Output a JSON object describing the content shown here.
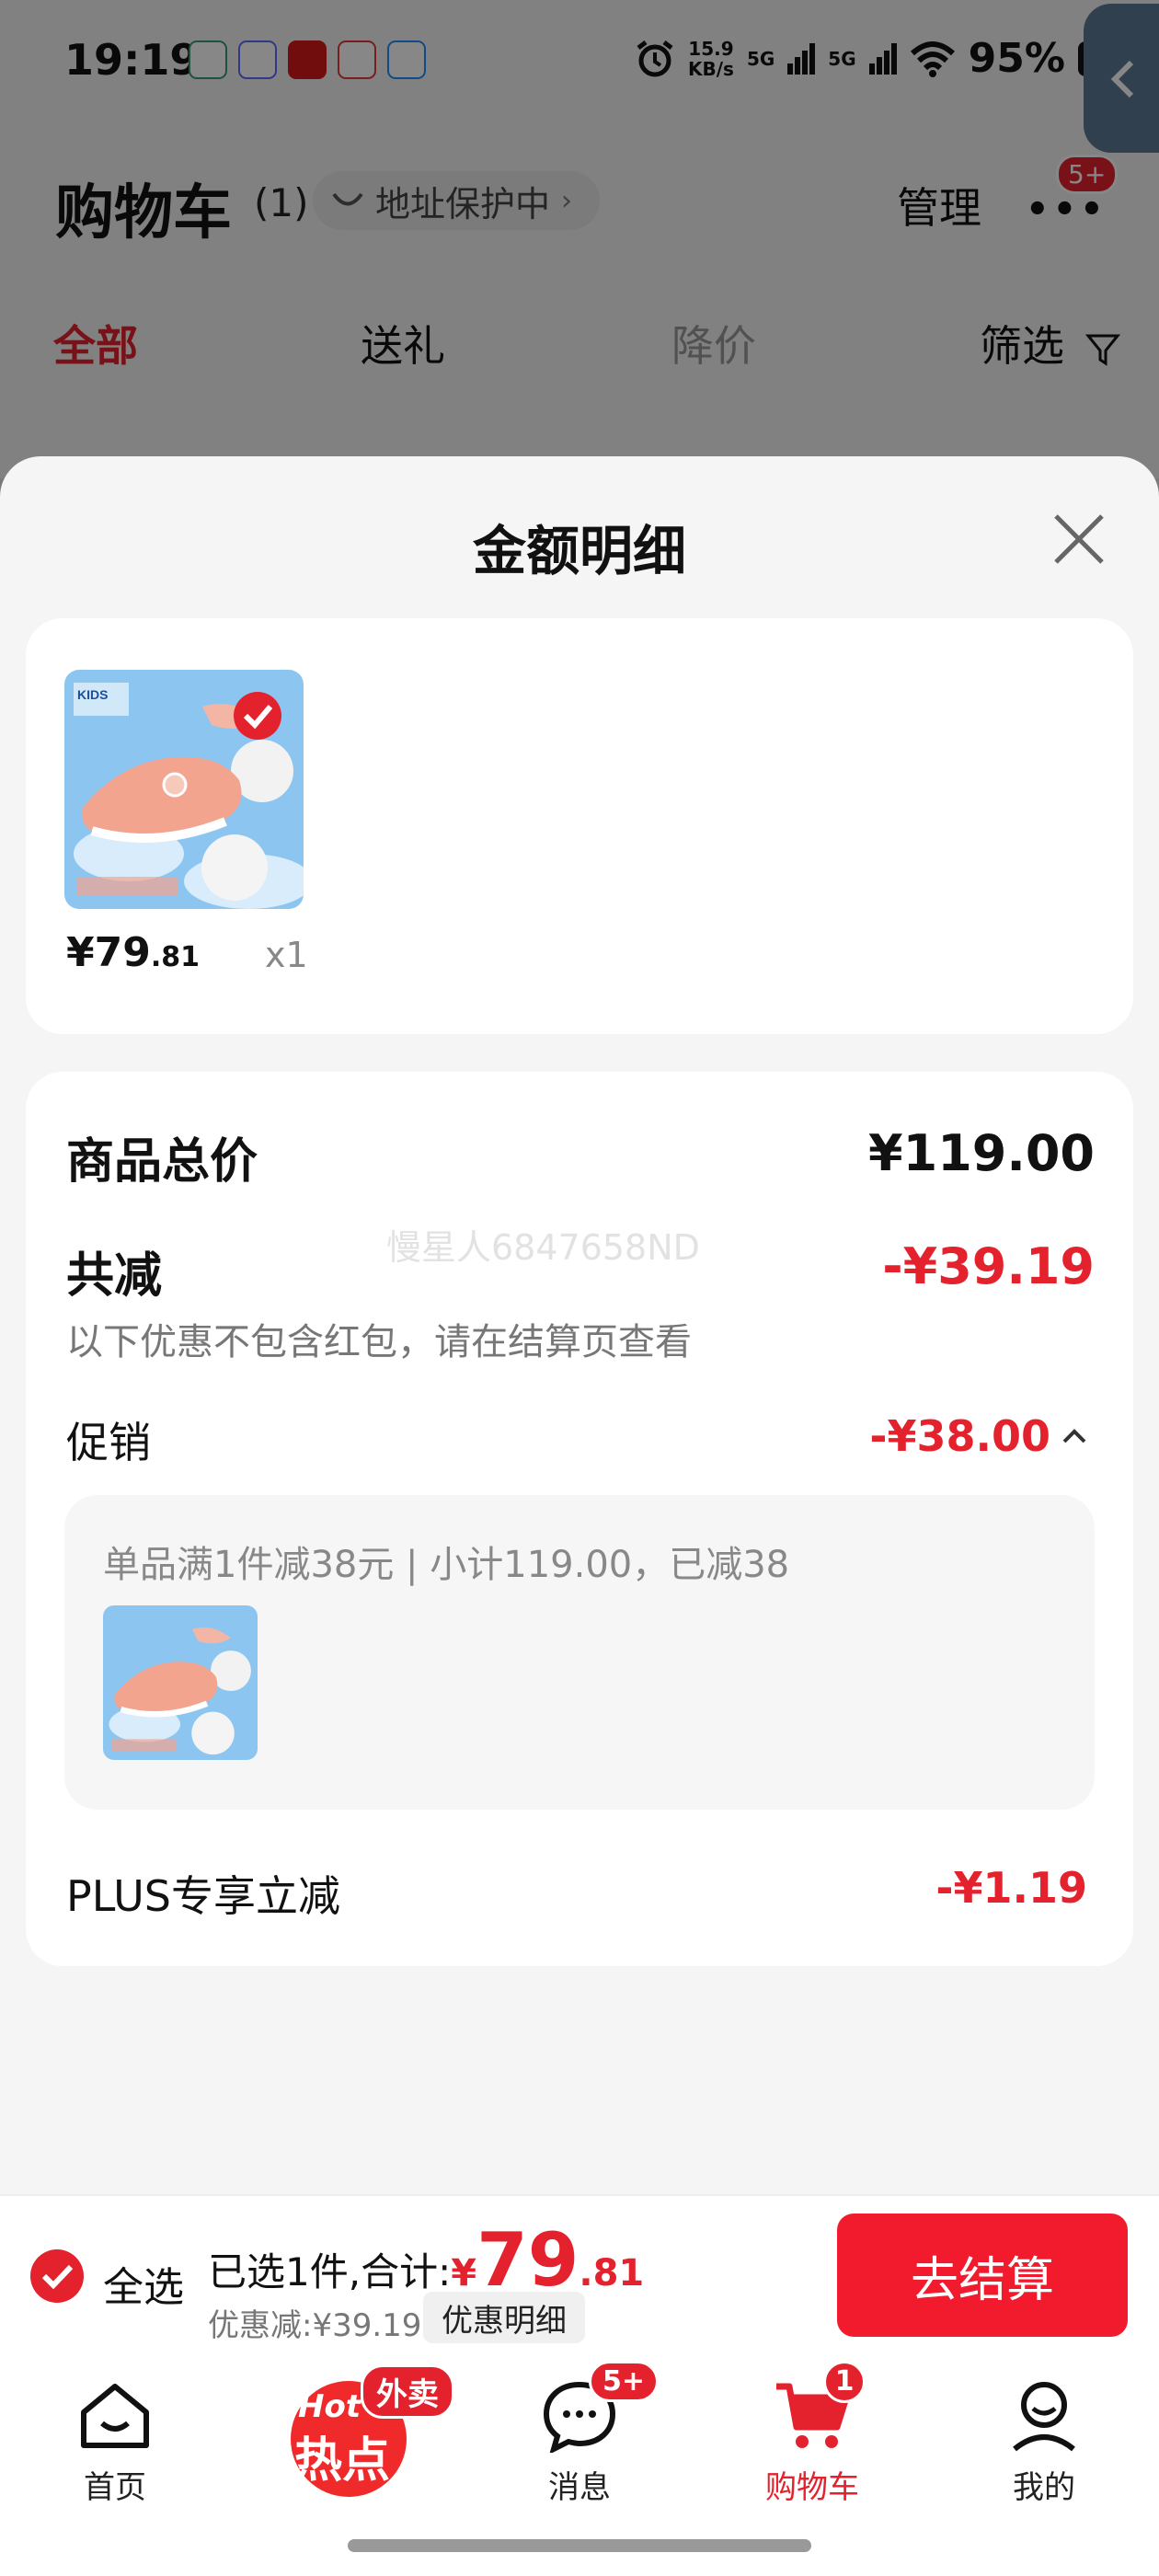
{
  "status_bar": {
    "time": "19:19",
    "net_speed_value": "15.9",
    "net_speed_unit": "KB/s",
    "signal1": "5G",
    "signal2": "5G",
    "battery": "95%"
  },
  "cart_header": {
    "title": "购物车",
    "count": "(1)",
    "address_protect": "地址保护中",
    "manage": "管理",
    "more_badge": "5+"
  },
  "tabs": [
    "全部",
    "送礼",
    "降价",
    "筛选"
  ],
  "sheet": {
    "title": "金额明细",
    "product": {
      "price_main": "¥79",
      "price_decimal": ".81",
      "qty": "x1"
    },
    "watermark": "慢星人6847658ND",
    "total_label": "商品总价",
    "total_value": "¥119.00",
    "reduce_label": "共减",
    "reduce_value": "-¥39.19",
    "note": "以下优惠不包含红包，请在结算页查看",
    "promo_label": "促销",
    "promo_value": "-¥38.00",
    "promo_detail": "单品满1件减38元 | 小计119.00，已减38",
    "plus_label": "PLUS专享立减",
    "plus_value": "-¥1.19"
  },
  "checkout": {
    "select_all": "全选",
    "selected_text": "已选1件,合计:",
    "currency": "¥",
    "total_int": "79",
    "total_dec": ".81",
    "discount": "优惠减:¥39.19",
    "detail_btn": "优惠明细",
    "pay_btn": "去结算"
  },
  "nav": {
    "home": "首页",
    "hot_top": "Hot",
    "hot_main": "热点",
    "hot_badge": "外卖",
    "messages": "消息",
    "messages_badge": "5+",
    "cart": "购物车",
    "cart_badge": "1",
    "mine": "我的"
  },
  "colors": {
    "accent": "#e4222e",
    "pay_button": "#f21b2e"
  },
  "icons": [
    "alarm-icon",
    "wifi-icon",
    "battery-icon",
    "back-chevron-icon",
    "filter-icon",
    "close-icon",
    "check-icon",
    "home-icon",
    "message-icon",
    "cart-icon",
    "user-icon"
  ]
}
